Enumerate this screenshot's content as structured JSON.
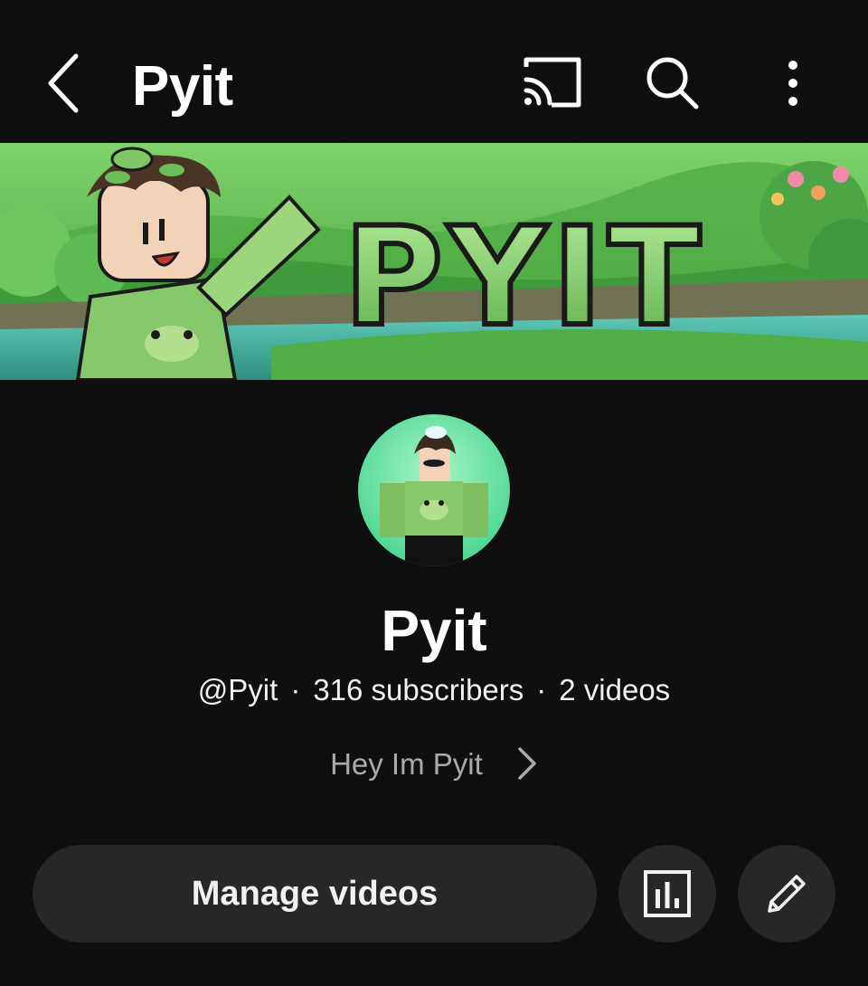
{
  "header": {
    "title": "Pyit",
    "icons": {
      "back": "chevron-left-icon",
      "cast": "cast-icon",
      "search": "search-icon",
      "more": "more-vertical-icon"
    }
  },
  "banner": {
    "text": "PYIT"
  },
  "channel": {
    "name": "Pyit",
    "handle": "@Pyit",
    "separator": "·",
    "subscribers": "316 subscribers",
    "videos": "2 videos",
    "description": "Hey Im Pyit"
  },
  "actions": {
    "manage_label": "Manage videos",
    "analytics_icon": "analytics-icon",
    "edit_icon": "pencil-icon"
  },
  "colors": {
    "background": "#0f0f0f",
    "button_bg": "#272727",
    "banner_green": "#56b34d",
    "text_primary": "#f1f1f1",
    "text_secondary": "#aaaaaa"
  }
}
